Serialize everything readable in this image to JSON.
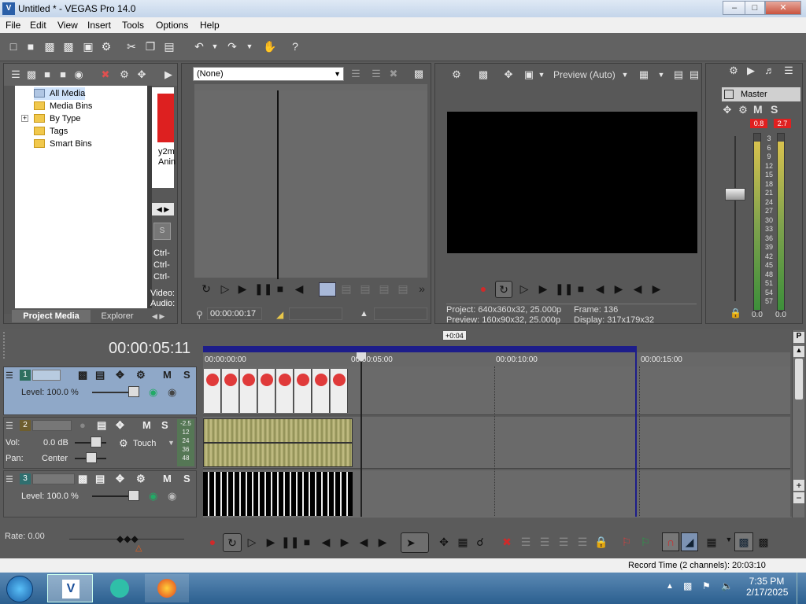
{
  "window": {
    "title": "Untitled * - VEGAS Pro 14.0",
    "app_icon": "vegas-icon"
  },
  "menu": [
    "File",
    "Edit",
    "View",
    "Insert",
    "Tools",
    "Options",
    "Help"
  ],
  "project_media": {
    "tabs": [
      "Project Media",
      "Explorer"
    ],
    "tree": [
      "All Media",
      "Media Bins",
      "By Type",
      "Tags",
      "Smart Bins"
    ],
    "thumb_caption_1": "y2m",
    "thumb_caption_2": "Anin",
    "ctrl_lines": [
      "Ctrl-",
      "Ctrl-",
      "Ctrl-"
    ],
    "meta": [
      "Video:",
      "Audio:"
    ]
  },
  "trimmer": {
    "preset": "(None)",
    "timecode": "00:00:00:17"
  },
  "preview": {
    "mode": "Preview (Auto)",
    "project_label": "Project:",
    "project_value": "640x360x32, 25.000p",
    "preview_label": "Preview:",
    "preview_value": "160x90x32, 25.000p",
    "frame_label": "Frame:",
    "frame_value": "136",
    "display_label": "Display:",
    "display_value": "317x179x32"
  },
  "master": {
    "label": "Master",
    "peak_left": "0.8",
    "peak_right": "2.7",
    "scale": [
      "3",
      "6",
      "9",
      "12",
      "15",
      "18",
      "21",
      "24",
      "27",
      "30",
      "33",
      "36",
      "39",
      "42",
      "45",
      "48",
      "51",
      "54",
      "57"
    ],
    "bottom_left": "0.0",
    "bottom_right": "0.0"
  },
  "timeline": {
    "timecode": "00:00:05:11",
    "offset_badge": "+0:04",
    "ruler": [
      "00:00:00:00",
      "00:00:05:00",
      "00:00:10:00",
      "00:00:15:00"
    ],
    "tracks": [
      {
        "num": "1",
        "type": "video",
        "level_label": "Level:",
        "level_value": "100.0 %"
      },
      {
        "num": "2",
        "type": "audio",
        "vol_label": "Vol:",
        "vol_value": "0.0 dB",
        "pan_label": "Pan:",
        "pan_value": "Center",
        "touch": "Touch",
        "meter": [
          "-2.5",
          "12",
          "24",
          "36",
          "48"
        ]
      },
      {
        "num": "3",
        "type": "video",
        "level_label": "Level:",
        "level_value": "100.0 %"
      }
    ],
    "rate_label": "Rate: 0.00"
  },
  "status": {
    "record_time": "Record Time (2 channels): 20:03:10"
  },
  "taskbar": {
    "time": "7:35 PM",
    "date": "2/17/2025"
  }
}
